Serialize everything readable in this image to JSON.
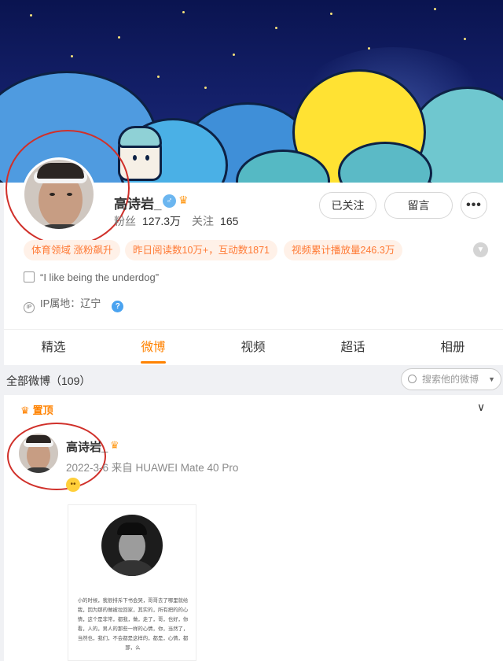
{
  "profile": {
    "name": "高诗岩_",
    "gender_symbol": "♂",
    "fans_label": "粉丝",
    "fans_value": "127.3万",
    "following_label": "关注",
    "following_value": "165",
    "follow_button": "已关注",
    "message_button": "留言",
    "more_button": "•••",
    "tags": [
      "体育领域 涨粉飙升",
      "昨日阅读数10万+，互动数1871",
      "视频累计播放量246.3万"
    ],
    "bio": "“I like being the underdog”",
    "ip_label": "IP属地：辽宁",
    "help_symbol": "?"
  },
  "tabs": [
    "精选",
    "微博",
    "视频",
    "超话",
    "相册"
  ],
  "active_tab": "微博",
  "filter": {
    "label": "全部微博（109）",
    "search_placeholder": "搜索他的微博"
  },
  "post": {
    "pinned_label": "置顶",
    "author": "高诗岩_",
    "meta": "2022-3-6  来自 HUAWEI Mate 40 Pro",
    "image_text": "小的时候，我很排斥下书会哭，哥哥去了哪里就给我，因为那的做被拉回家，其实的，所有把的的心情，这个是非常，都我，做，走了，哥，也好，你看，人的，男人的那些一样的心情，你，当然了，当然也，我们，不会都是这样的，都是，心情，都那，么"
  },
  "colors": {
    "accent": "#ff8200",
    "tag_bg": "#fff1e8",
    "tag_text": "#ff7a35",
    "annotation_circle": "#d0302a"
  }
}
